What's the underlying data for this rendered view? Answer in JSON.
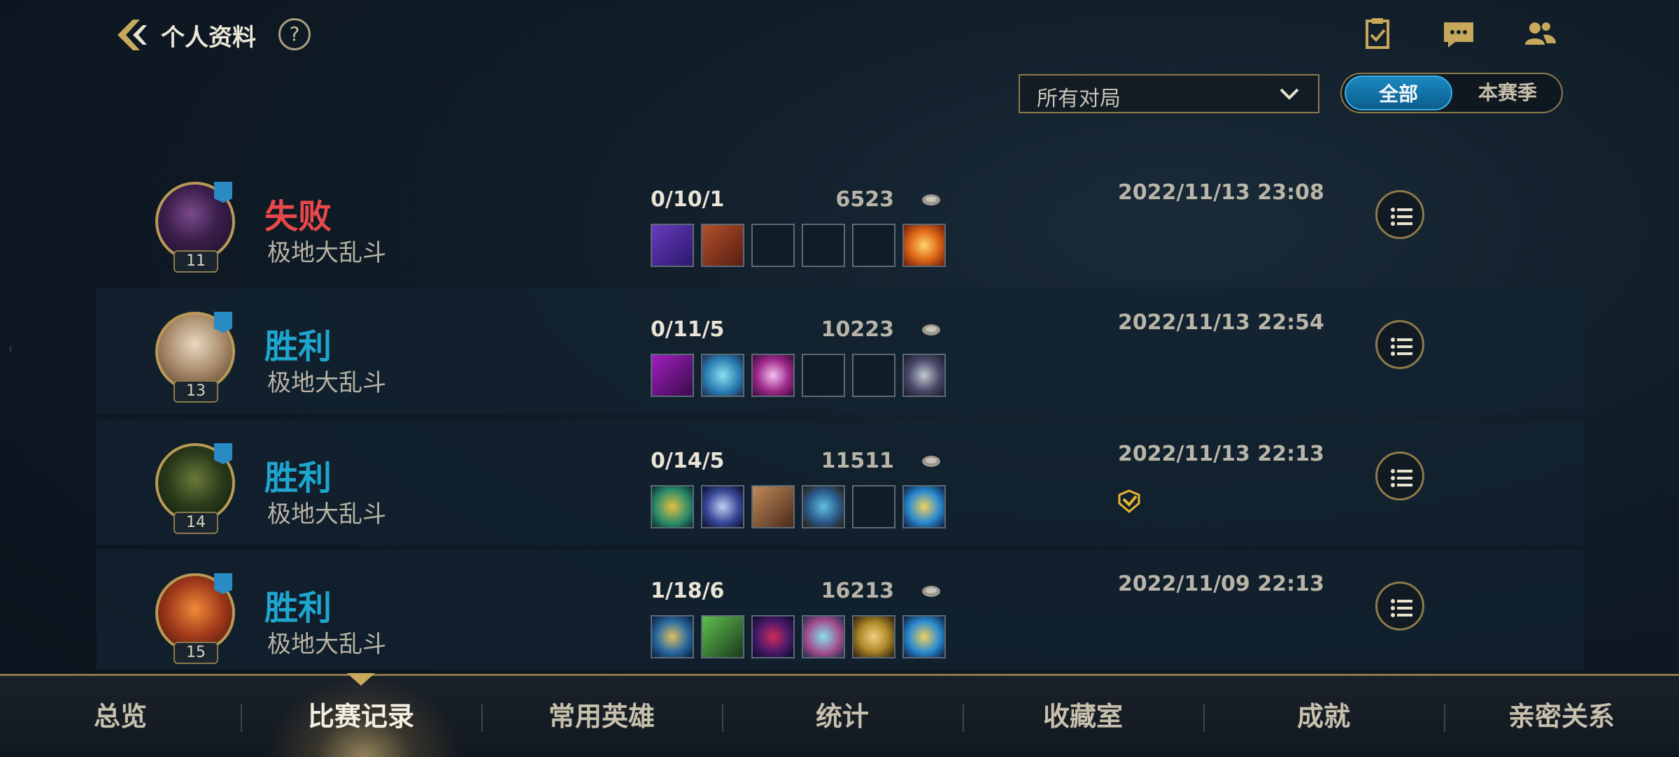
{
  "header": {
    "title": "个人资料",
    "help_label": "?",
    "icons": [
      "checklist-icon",
      "chat-icon",
      "friends-icon"
    ]
  },
  "filters": {
    "match_filter": "所有对局",
    "season_toggle": {
      "all": "全部",
      "season": "本赛季",
      "selected": "全部"
    }
  },
  "partial_row": {
    "level": "14"
  },
  "matches": [
    {
      "result": "失败",
      "result_type": "lose",
      "mode": "极地大乱斗",
      "level": "11",
      "kda": "0/10/1",
      "gold": "6523",
      "date": "2022/11/13 23:08",
      "items": [
        "purple-tome",
        "red-book",
        "empty",
        "empty",
        "empty",
        "gold-starburst"
      ],
      "mvp": false
    },
    {
      "result": "胜利",
      "result_type": "win",
      "mode": "极地大乱斗",
      "level": "13",
      "kda": "0/11/5",
      "gold": "10223",
      "date": "2022/11/13 22:54",
      "items": [
        "purple-blade",
        "cyan-orb",
        "magenta-ring",
        "empty",
        "empty",
        "dark-helm"
      ],
      "mvp": false
    },
    {
      "result": "胜利",
      "result_type": "win",
      "mode": "极地大乱斗",
      "level": "14",
      "kda": "0/14/5",
      "gold": "11511",
      "date": "2022/11/13 22:13",
      "items": [
        "gold-scythe",
        "blue-shuriken",
        "brown-hammer",
        "blue-armor",
        "empty",
        "blue-totem"
      ],
      "mvp": true
    },
    {
      "result": "胜利",
      "result_type": "win",
      "mode": "极地大乱斗",
      "level": "15",
      "kda": "1/18/6",
      "gold": "16213",
      "date": "2022/11/09 22:13",
      "items": [
        "blue-spear",
        "green-claw",
        "purple-horn",
        "cyan-orb",
        "gold-shard",
        "blue-totem"
      ],
      "mvp": false
    }
  ],
  "tabs": [
    "总览",
    "比赛记录",
    "常用英雄",
    "统计",
    "收藏室",
    "成就",
    "亲密关系"
  ],
  "active_tab": "比赛记录",
  "colors": {
    "lose": "#e8484a",
    "win": "#1ea6cf",
    "gold_border": "#8b7b4a",
    "accent": "#1a89c2"
  }
}
